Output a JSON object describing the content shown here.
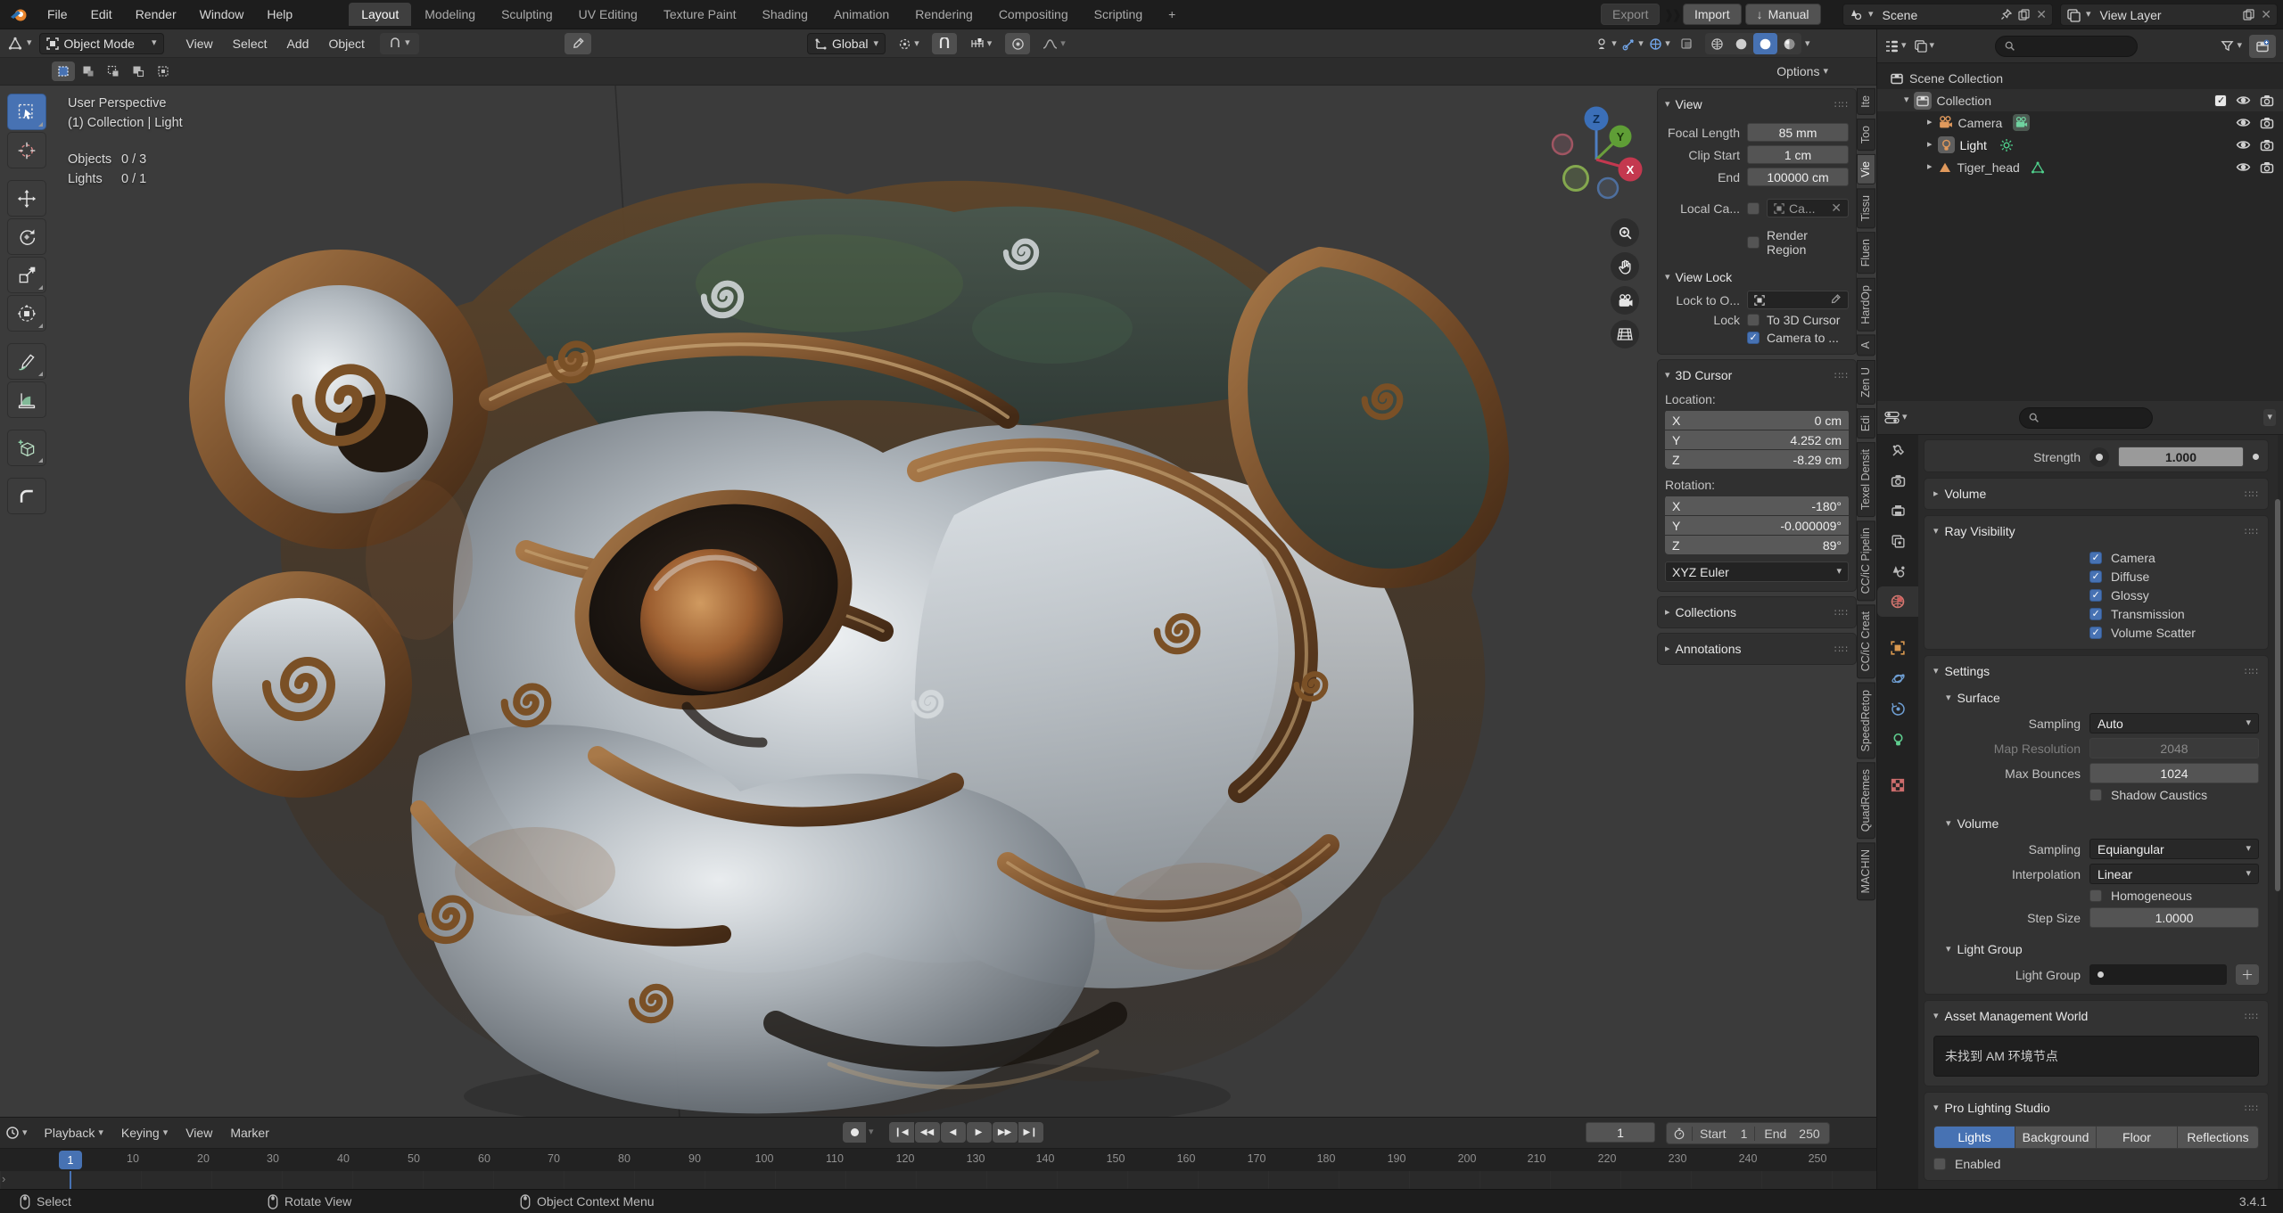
{
  "topbar": {
    "menus": [
      "File",
      "Edit",
      "Render",
      "Window",
      "Help"
    ],
    "workspaces": [
      "Layout",
      "Modeling",
      "Sculpting",
      "UV Editing",
      "Texture Paint",
      "Shading",
      "Animation",
      "Rendering",
      "Compositing",
      "Scripting"
    ],
    "active_workspace": "Layout",
    "new_workspace_button": "+",
    "export_label": "Export",
    "import_label": "Import",
    "manual_label": "Manual",
    "scene_name": "Scene",
    "view_layer_name": "View Layer"
  },
  "viewport_header": {
    "mode": "Object Mode",
    "menus": [
      "View",
      "Select",
      "Add",
      "Object"
    ],
    "orientation": "Global",
    "options_label": "Options"
  },
  "tools": [
    "select-box",
    "cursor",
    "move",
    "rotate",
    "scale",
    "transform",
    "annotate",
    "measure",
    "add-cube",
    "corner-tool"
  ],
  "viewport": {
    "overlay_line1": "User Perspective",
    "overlay_line2": "(1) Collection | Light",
    "objects_label": "Objects",
    "objects_value": "0 / 3",
    "lights_label": "Lights",
    "lights_value": "0 / 1",
    "axis": {
      "x": "X",
      "y": "Y",
      "z": "Z"
    }
  },
  "n_panel": {
    "tabs": [
      "Ite",
      "Too",
      "Vie",
      "Tissu",
      "Fluen",
      "HardOp",
      "A",
      "Zen U",
      "Edi",
      "Texel Densit",
      "CC/iC Pipelin",
      "CC/iC Creat",
      "SpeedRetop",
      "QuadRemes",
      "MACHIN"
    ],
    "active_tab": "Vie",
    "view": {
      "title": "View",
      "focal_label": "Focal Length",
      "focal_value": "85 mm",
      "clip_start_label": "Clip Start",
      "clip_start_value": "1 cm",
      "clip_end_label": "End",
      "clip_end_value": "100000 cm",
      "local_camera_label": "Local Ca...",
      "local_camera_value": "Ca...",
      "render_region_label": "Render Region",
      "view_lock_title": "View Lock",
      "lock_to_label": "Lock to O...",
      "lock_label": "Lock",
      "to_3d_cursor_label": "To 3D Cursor",
      "camera_to_label": "Camera to ..."
    },
    "cursor": {
      "title": "3D Cursor",
      "location_label": "Location:",
      "loc_x_axis": "X",
      "loc_x": "0 cm",
      "loc_y_axis": "Y",
      "loc_y": "4.252 cm",
      "loc_z_axis": "Z",
      "loc_z": "-8.29 cm",
      "rotation_label": "Rotation:",
      "rot_x_axis": "X",
      "rot_x": "-180°",
      "rot_y_axis": "Y",
      "rot_y": "-0.000009°",
      "rot_z_axis": "Z",
      "rot_z": "89°",
      "euler": "XYZ Euler"
    },
    "collections_title": "Collections",
    "annotations_title": "Annotations"
  },
  "outliner": {
    "scene_collection": "Scene Collection",
    "collection": "Collection",
    "items": [
      "Camera",
      "Light",
      "Tiger_head"
    ]
  },
  "properties": {
    "strength_label": "Strength",
    "strength_value": "1.000",
    "volume_collapsed_title": "Volume",
    "ray_visibility_title": "Ray Visibility",
    "ray_options": [
      "Camera",
      "Diffuse",
      "Glossy",
      "Transmission",
      "Volume Scatter"
    ],
    "settings_title": "Settings",
    "surface_title": "Surface",
    "sampling_label": "Sampling",
    "sampling_value": "Auto",
    "map_resolution_label": "Map Resolution",
    "map_resolution_value": "2048",
    "max_bounces_label": "Max Bounces",
    "max_bounces_value": "1024",
    "shadow_caustics_label": "Shadow Caustics",
    "volume_title": "Volume",
    "volume_sampling_label": "Sampling",
    "volume_sampling_value": "Equiangular",
    "interpolation_label": "Interpolation",
    "interpolation_value": "Linear",
    "homogeneous_label": "Homogeneous",
    "step_size_label": "Step Size",
    "step_size_value": "1.0000",
    "light_group_title": "Light Group",
    "light_group_label": "Light Group",
    "asset_mgmt_title": "Asset Management World",
    "asset_mgmt_message": "未找到 AM 环境节点",
    "pro_lighting_title": "Pro Lighting Studio",
    "pro_lighting_tabs": [
      "Lights",
      "Background",
      "Floor",
      "Reflections"
    ],
    "pro_lighting_active": "Lights",
    "enabled_label": "Enabled"
  },
  "timeline": {
    "menus": [
      "Playback",
      "Keying",
      "View",
      "Marker"
    ],
    "current_frame": "1",
    "start_label": "Start",
    "start_value": "1",
    "end_label": "End",
    "end_value": "250",
    "ticks": [
      "1",
      "10",
      "20",
      "30",
      "40",
      "50",
      "60",
      "70",
      "80",
      "90",
      "100",
      "110",
      "120",
      "130",
      "140",
      "150",
      "160",
      "170",
      "180",
      "190",
      "200",
      "210",
      "220",
      "230",
      "240",
      "250"
    ]
  },
  "statusbar": {
    "hint_left": "Select",
    "hint_middle": "Rotate View",
    "hint_right": "Object Context Menu",
    "version": "3.4.1"
  },
  "icons": {
    "search": "search-icon",
    "funnel": "filter-icon",
    "eye": "visibility-eye-icon",
    "camera": "render-visibility-icon",
    "magnet": "snap-magnet-icon",
    "grip": "panel-drag-grip"
  },
  "colors": {
    "accent_blue": "#4772b3",
    "viewport_bg": "#3b3b3b",
    "header_bg": "#1d1d1d"
  }
}
